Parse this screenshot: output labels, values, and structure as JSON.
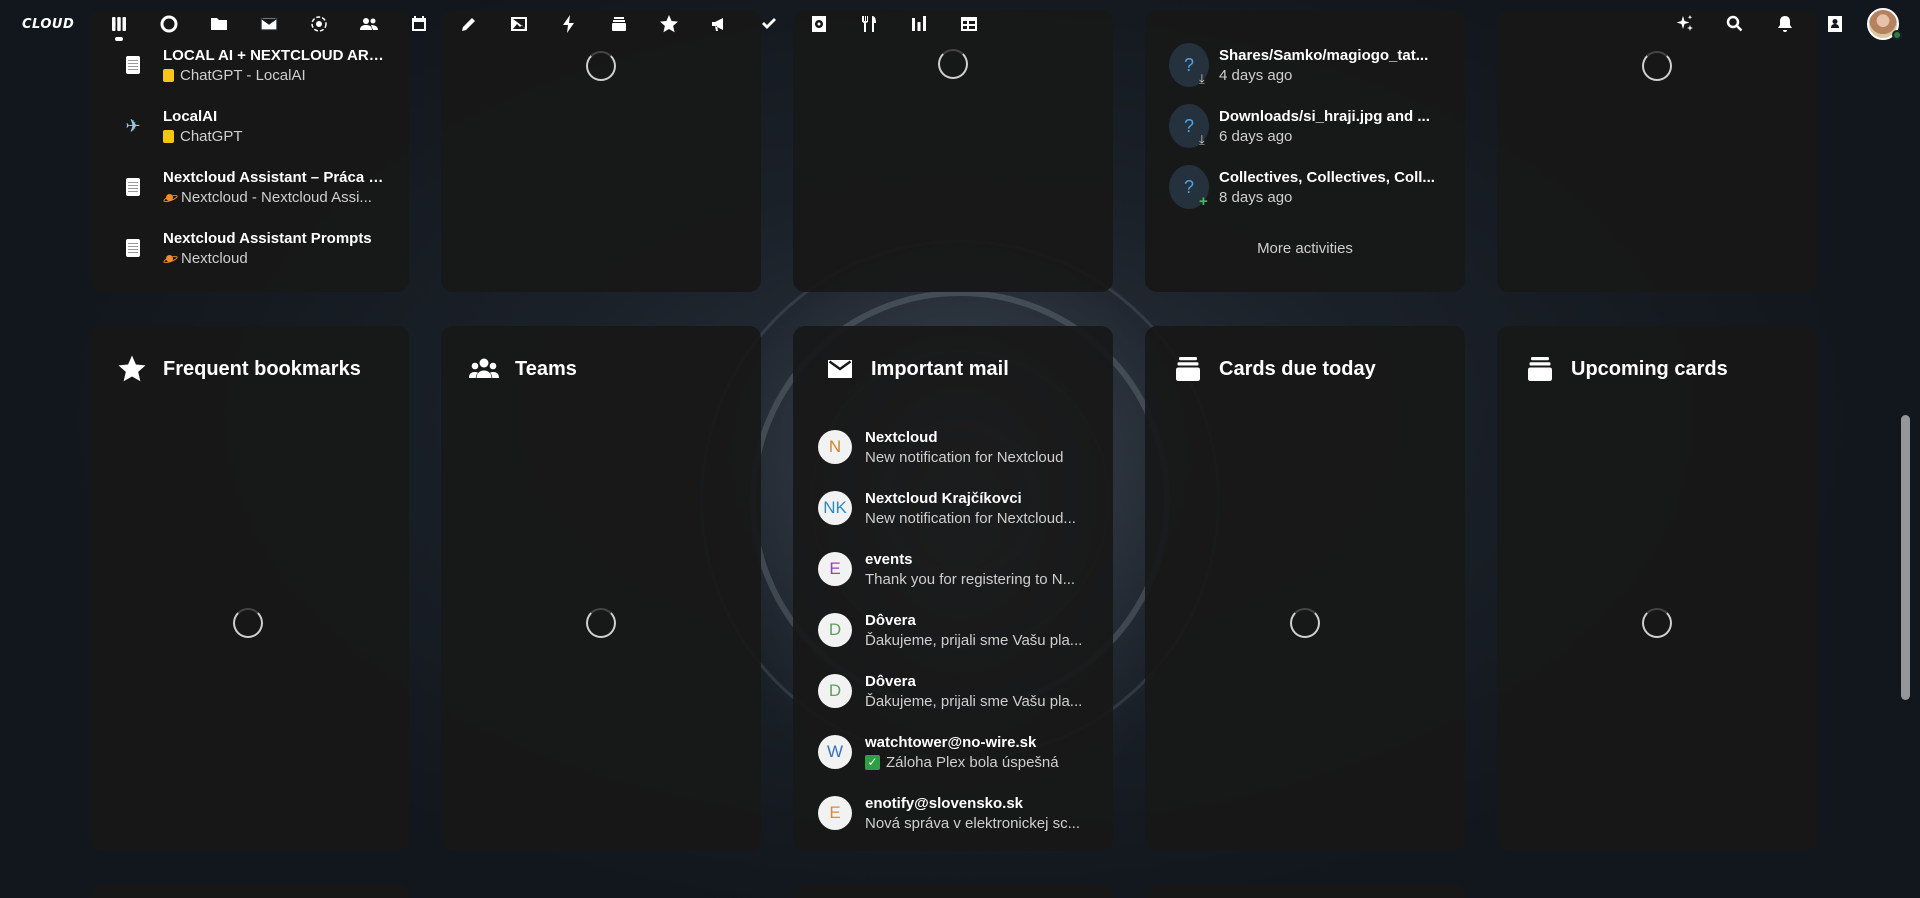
{
  "header": {
    "logo": "CLOUD",
    "apps": [
      {
        "name": "dashboard",
        "icon": "dashboard-icon",
        "active": true
      },
      {
        "name": "activity",
        "icon": "activity-icon"
      },
      {
        "name": "files",
        "icon": "folder-icon"
      },
      {
        "name": "mail",
        "icon": "mail-icon"
      },
      {
        "name": "circles",
        "icon": "circles-icon"
      },
      {
        "name": "contacts",
        "icon": "contacts-icon"
      },
      {
        "name": "calendar",
        "icon": "calendar-icon"
      },
      {
        "name": "notes",
        "icon": "pencil-icon"
      },
      {
        "name": "photos",
        "icon": "image-icon"
      },
      {
        "name": "flow",
        "icon": "lightning-icon"
      },
      {
        "name": "deck",
        "icon": "deck-icon"
      },
      {
        "name": "bookmarks",
        "icon": "star-icon"
      },
      {
        "name": "announcements",
        "icon": "megaphone-icon"
      },
      {
        "name": "tasks",
        "icon": "checkmark-icon"
      },
      {
        "name": "passwords",
        "icon": "vault-icon"
      },
      {
        "name": "cookbook",
        "icon": "cutlery-icon"
      },
      {
        "name": "analytics",
        "icon": "bar-chart-icon"
      },
      {
        "name": "tables",
        "icon": "table-icon"
      }
    ],
    "right_icons": [
      "assistant-icon",
      "search-icon",
      "bell-icon",
      "contacts-menu-icon"
    ]
  },
  "top_panels": {
    "notes": {
      "items": [
        {
          "title": "LOCAL AI + NEXTCLOUD ARCH...",
          "sub": "ChatGPT - LocalAI",
          "lead": "note-icon",
          "sub_icon": "yellow"
        },
        {
          "title": "LocalAI",
          "sub": "ChatGPT",
          "lead": "airplane-icon",
          "sub_icon": "yellow"
        },
        {
          "title": "Nextcloud Assistant – Práca s ...",
          "sub": "Nextcloud - Nextcloud Assi...",
          "lead": "note-icon",
          "sub_icon": "planet"
        },
        {
          "title": "Nextcloud Assistant Prompts",
          "sub": "Nextcloud",
          "lead": "note-icon",
          "sub_icon": "planet"
        }
      ]
    },
    "activity": {
      "items": [
        {
          "title": "Shares/Samko/magiogo_tat...",
          "sub": "4 days ago",
          "badge": "download"
        },
        {
          "title": "Downloads/si_hraji.jpg and ...",
          "sub": "6 days ago",
          "badge": "download"
        },
        {
          "title": "Collectives, Collectives, Coll...",
          "sub": "8 days ago",
          "badge": "add"
        }
      ],
      "more": "More activities"
    }
  },
  "widgets": {
    "bookmarks": {
      "title": "Frequent bookmarks"
    },
    "teams": {
      "title": "Teams"
    },
    "mail": {
      "title": "Important mail",
      "items": [
        {
          "initials": "N",
          "color": "#d9822b",
          "from": "Nextcloud",
          "subject": "New notification for Nextcloud"
        },
        {
          "initials": "NK",
          "color": "#2e8bbf",
          "from": "Nextcloud Krajčíkovci",
          "subject": "New notification for Nextcloud..."
        },
        {
          "initials": "E",
          "color": "#9b3dbf",
          "from": "events",
          "subject": "Thank you for registering to N..."
        },
        {
          "initials": "D",
          "color": "#5aa35a",
          "from": "Dôvera",
          "subject": "Ďakujeme, prijali sme Vašu pla..."
        },
        {
          "initials": "D",
          "color": "#5aa35a",
          "from": "Dôvera",
          "subject": "Ďakujeme, prijali sme Vašu pla..."
        },
        {
          "initials": "W",
          "color": "#3a6fbf",
          "from": "watchtower@no-wire.sk",
          "subject": "Záloha Plex bola úspešná",
          "check": true
        },
        {
          "initials": "E",
          "color": "#d98a3d",
          "from": "enotify@slovensko.sk",
          "subject": "Nová správa v elektronickej sc..."
        }
      ]
    },
    "cards_today": {
      "title": "Cards due today"
    },
    "upcoming": {
      "title": "Upcoming cards"
    }
  }
}
